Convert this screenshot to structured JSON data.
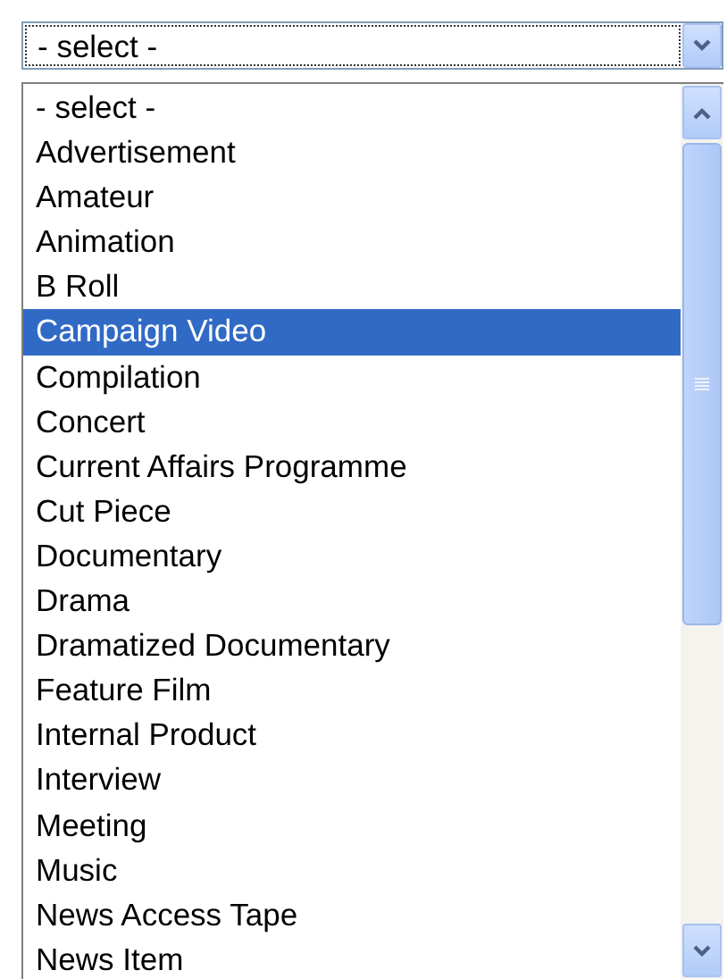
{
  "select": {
    "value": "- select -",
    "expanded": true
  },
  "options": [
    {
      "label": "- select -",
      "selected": false
    },
    {
      "label": "Advertisement",
      "selected": false
    },
    {
      "label": "Amateur",
      "selected": false
    },
    {
      "label": "Animation",
      "selected": false
    },
    {
      "label": "B Roll",
      "selected": false
    },
    {
      "label": "Campaign Video",
      "selected": true
    },
    {
      "label": "Compilation",
      "selected": false
    },
    {
      "label": "Concert",
      "selected": false
    },
    {
      "label": "Current Affairs Programme",
      "selected": false
    },
    {
      "label": "Cut Piece",
      "selected": false
    },
    {
      "label": "Documentary",
      "selected": false
    },
    {
      "label": "Drama",
      "selected": false
    },
    {
      "label": "Dramatized Documentary",
      "selected": false
    },
    {
      "label": "Feature Film",
      "selected": false
    },
    {
      "label": "Internal Product",
      "selected": false
    },
    {
      "label": "Interview",
      "selected": false
    },
    {
      "label": "Meeting",
      "selected": false
    },
    {
      "label": "Music",
      "selected": false
    },
    {
      "label": "News Access Tape",
      "selected": false
    },
    {
      "label": "News Item",
      "selected": false
    }
  ]
}
